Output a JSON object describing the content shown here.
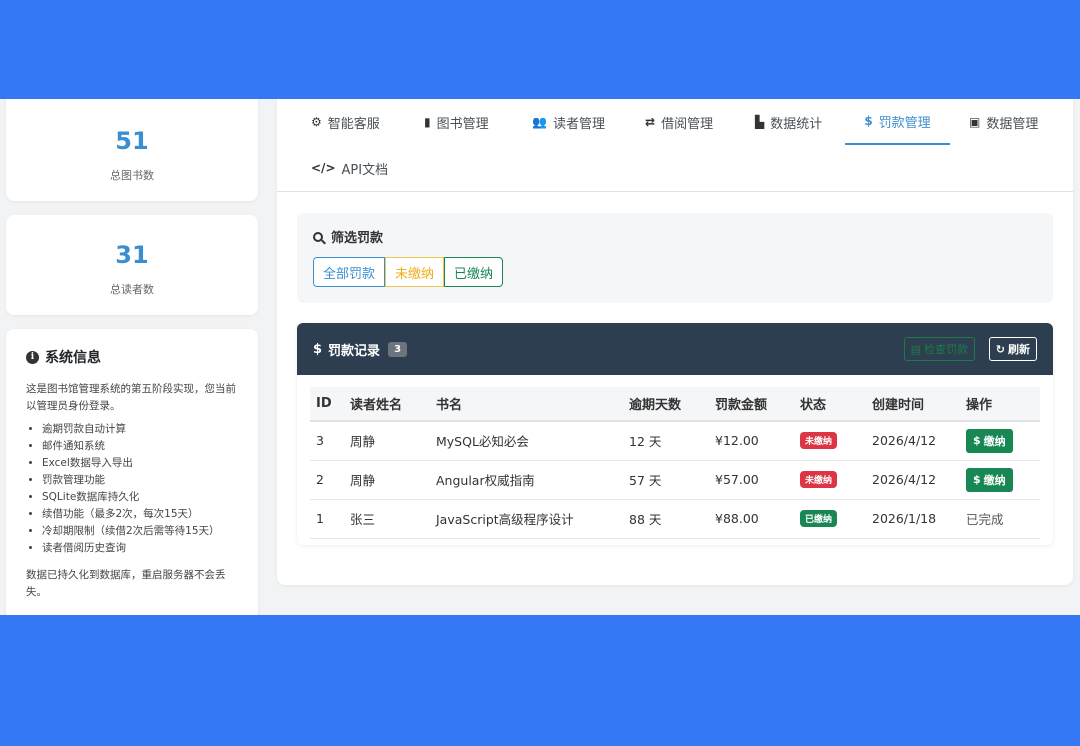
{
  "stats": {
    "books": {
      "value": "51",
      "label": "总图书数"
    },
    "readers": {
      "value": "31",
      "label": "总读者数"
    }
  },
  "system_info": {
    "title": "系统信息",
    "description": "这是图书馆管理系统的第五阶段实现，您当前以管理员身份登录。",
    "features": [
      "逾期罚款自动计算",
      "邮件通知系统",
      "Excel数据导入导出",
      "罚款管理功能",
      "SQLite数据库持久化",
      "续借功能（最多2次，每次15天）",
      "冷却期限制（续借2次后需等待15天）",
      "读者借阅历史查询"
    ],
    "note": "数据已持久化到数据库，重启服务器不会丢失。"
  },
  "tabs": [
    {
      "label": "智能客服",
      "icon": "robot-icon",
      "glyph": "⚙"
    },
    {
      "label": "图书管理",
      "icon": "book-icon",
      "glyph": "▮"
    },
    {
      "label": "读者管理",
      "icon": "users-icon",
      "glyph": "👥"
    },
    {
      "label": "借阅管理",
      "icon": "exchange-icon",
      "glyph": "⇄"
    },
    {
      "label": "数据统计",
      "icon": "chart-icon",
      "glyph": "▙"
    },
    {
      "label": "罚款管理",
      "icon": "dollar-icon",
      "glyph": "$"
    },
    {
      "label": "数据管理",
      "icon": "file-excel-icon",
      "glyph": "▣"
    },
    {
      "label": "API文档",
      "icon": "code-icon",
      "glyph": "</>"
    }
  ],
  "filter": {
    "title": "筛选罚款",
    "buttons": {
      "all": "全部罚款",
      "unpaid": "未缴纳",
      "paid": "已缴纳"
    }
  },
  "records": {
    "title": "罚款记录",
    "count": "3",
    "check_label": "检查罚款",
    "refresh_label": "刷新",
    "columns": [
      "ID",
      "读者姓名",
      "书名",
      "逾期天数",
      "罚款金额",
      "状态",
      "创建时间",
      "操作"
    ],
    "rows": [
      {
        "id": "3",
        "reader": "周静",
        "book": "MySQL必知必会",
        "days": "12 天",
        "amount": "¥12.00",
        "status": "未缴纳",
        "created": "2026/4/12",
        "action": "缴纳"
      },
      {
        "id": "2",
        "reader": "周静",
        "book": "Angular权威指南",
        "days": "57 天",
        "amount": "¥57.00",
        "status": "未缴纳",
        "created": "2026/4/12",
        "action": "缴纳"
      },
      {
        "id": "1",
        "reader": "张三",
        "book": "JavaScript高级程序设计",
        "days": "88 天",
        "amount": "¥88.00",
        "status": "已缴纳",
        "created": "2026/1/18",
        "action": "已完成"
      }
    ]
  },
  "colors": {
    "page_bg": "#3478f6",
    "accent": "#3b8fd0",
    "header_dark": "#2c3e50",
    "danger": "#dc3545",
    "success": "#198754",
    "warning": "#f0ad1c"
  }
}
